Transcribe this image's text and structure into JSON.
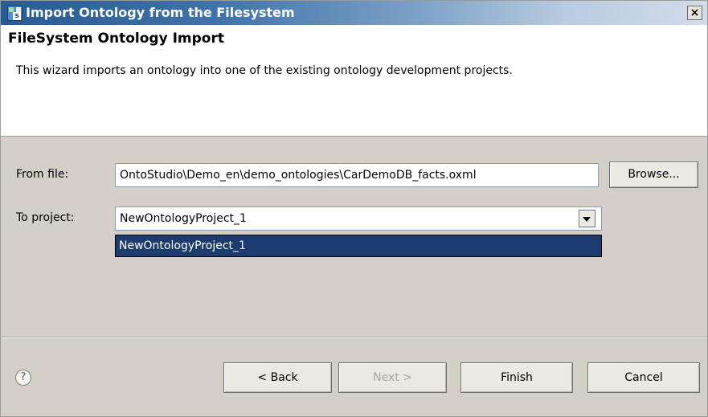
{
  "window": {
    "title": "Import Ontology from the Filesystem",
    "app_icon_letter": "s",
    "close_glyph": "×"
  },
  "header": {
    "title": "FileSystem Ontology Import",
    "description": "This wizard imports an ontology into one of the existing ontology development projects."
  },
  "form": {
    "from_file_label": "From file:",
    "from_file_value": "OntoStudio\\Demo_en\\demo_ontologies\\CarDemoDB_facts.oxml",
    "browse_label": "Browse...",
    "to_project_label": "To project:",
    "to_project_value": "NewOntologyProject_1",
    "dropdown_options": [
      "NewOntologyProject_1"
    ]
  },
  "footer": {
    "help_glyph": "?",
    "back_label": "< Back",
    "next_label": "Next >",
    "finish_label": "Finish",
    "cancel_label": "Cancel"
  },
  "colors": {
    "title_bar": "#2a5b94",
    "selection": "#1c3b6e",
    "dialog_bg": "#d4d0c8"
  }
}
